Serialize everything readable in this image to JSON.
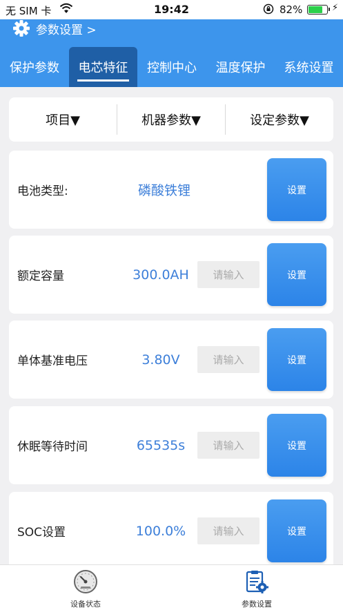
{
  "status_bar": {
    "carrier": "无 SIM 卡",
    "time": "19:42",
    "battery_percent_text": "82%",
    "battery_level": 0.82
  },
  "header": {
    "breadcrumb": "参数设置 >",
    "tabs": [
      {
        "label": "保护参数",
        "active": false
      },
      {
        "label": "电芯特征",
        "active": true
      },
      {
        "label": "控制中心",
        "active": false
      },
      {
        "label": "温度保护",
        "active": false
      },
      {
        "label": "系统设置",
        "active": false
      }
    ]
  },
  "columns": {
    "item": "项目▼",
    "machine_param": "机器参数▼",
    "set_param": "设定参数▼"
  },
  "rows": [
    {
      "label": "电池类型:",
      "value": "磷酸铁锂",
      "has_input": false,
      "button": "设置"
    },
    {
      "label": "额定容量",
      "value": "300.0AH",
      "has_input": true,
      "placeholder": "请输入",
      "button": "设置"
    },
    {
      "label": "单体基准电压",
      "value": "3.80V",
      "has_input": true,
      "placeholder": "请输入",
      "button": "设置"
    },
    {
      "label": "休眠等待时间",
      "value": "65535s",
      "has_input": true,
      "placeholder": "请输入",
      "button": "设置"
    },
    {
      "label": "SOC设置",
      "value": "100.0%",
      "has_input": true,
      "placeholder": "请输入",
      "button": "设置"
    }
  ],
  "bottom_nav": {
    "items": [
      {
        "label": "设备状态",
        "icon": "speedometer-icon"
      },
      {
        "label": "参数设置",
        "icon": "clipboard-gear-icon",
        "active": true
      }
    ]
  },
  "colors": {
    "header_blue": "#3d95ec",
    "active_tab": "#1f5fa6",
    "value_blue": "#3d7fd9",
    "button_blue": "#2c84e8",
    "battery_green": "#2bd04a"
  }
}
